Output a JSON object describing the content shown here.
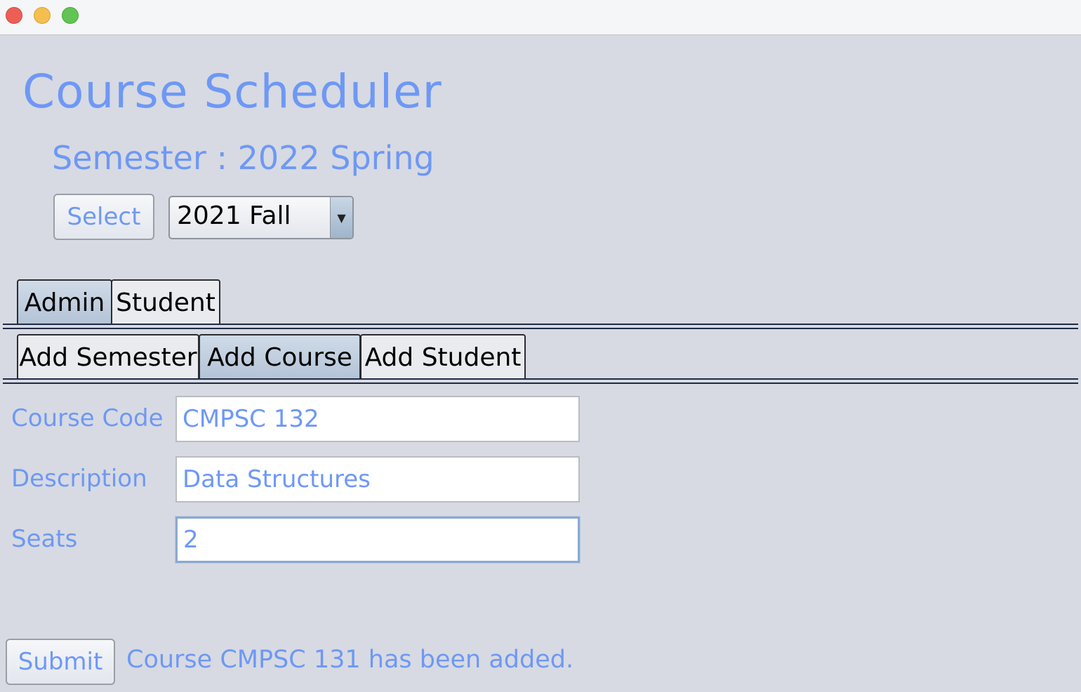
{
  "window": {
    "controls": [
      "close",
      "minimize",
      "maximize"
    ]
  },
  "header": {
    "title": "Course Scheduler",
    "semester_label": "Semester : 2022 Spring"
  },
  "semester_picker": {
    "select_label": "Select",
    "selected_value": "2021 Fall",
    "arrow_icon": "chevron-down-icon"
  },
  "main_tabs": [
    {
      "label": "Admin",
      "selected": true
    },
    {
      "label": "Student",
      "selected": false
    }
  ],
  "admin_tabs": [
    {
      "label": "Add Semester",
      "selected": false
    },
    {
      "label": "Add Course",
      "selected": true
    },
    {
      "label": "Add Student",
      "selected": false
    }
  ],
  "form": {
    "course_code_label": "Course Code",
    "course_code_value": "CMPSC 132",
    "description_label": "Description",
    "description_value": "Data Structures",
    "seats_label": "Seats",
    "seats_value": "2"
  },
  "footer": {
    "submit_label": "Submit",
    "status_message": "Course CMPSC 131 has been added."
  },
  "colors": {
    "accent": "#6e98f5",
    "background": "#d7dae2",
    "selected_tab": "#b3c3d6"
  }
}
